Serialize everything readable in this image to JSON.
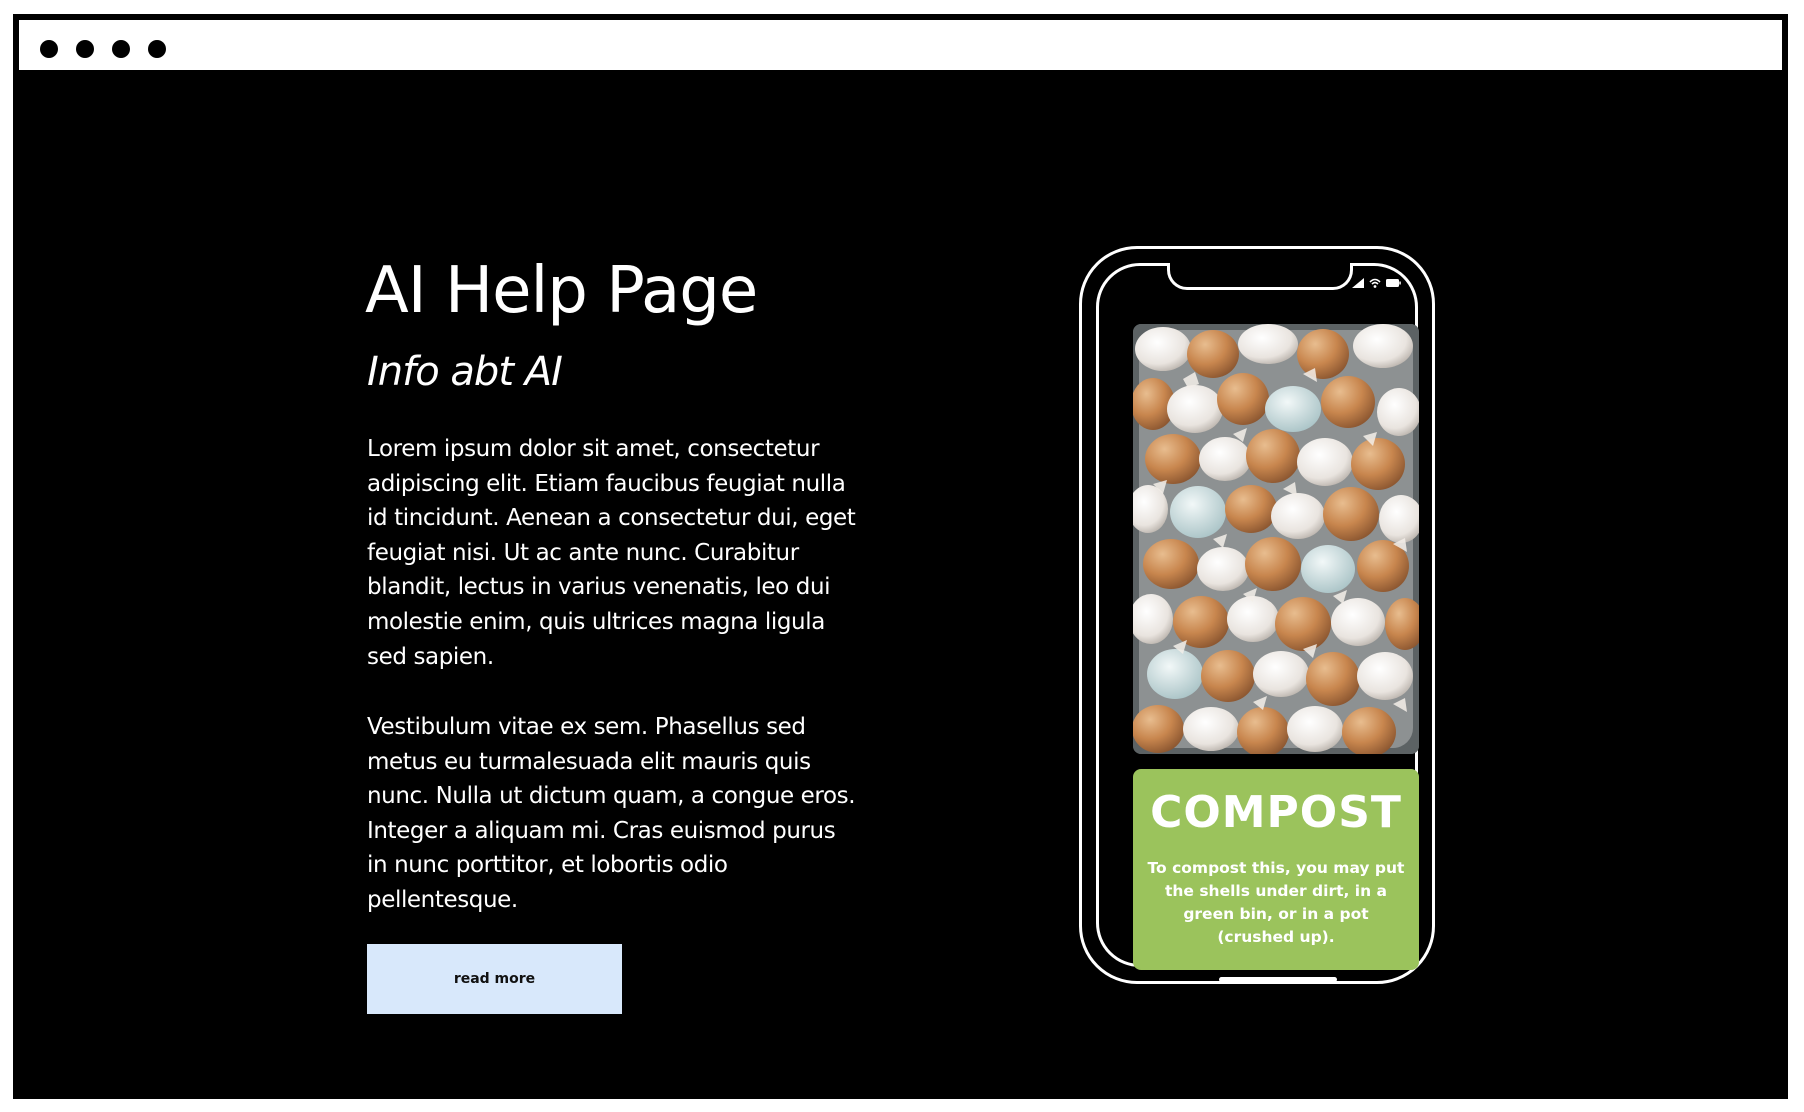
{
  "window": {
    "controls": [
      "dot",
      "dot",
      "dot",
      "dot"
    ]
  },
  "hero": {
    "title": "AI Help Page",
    "subtitle": "Info abt AI",
    "paragraph_1": "Lorem ipsum dolor sit amet, consectetur adipiscing elit. Etiam faucibus feugiat nulla id tincidunt. Aenean a consectetur dui, eget feugiat nisi. Ut ac ante nunc. Curabitur blandit, lectus in varius venenatis, leo dui molestie enim, quis ultrices magna ligula sed sapien.",
    "paragraph_2": "Vestibulum vitae ex sem. Phasellus sed metus eu turmalesuada elit mauris quis nunc. Nulla ut dictum quam, a congue eros. Integer a aliquam mi. Cras euismod purus in nunc porttitor, et lobortis odio pellentesque.",
    "button_label": "read more"
  },
  "phone": {
    "status_icons": [
      "signal-icon",
      "wifi-icon",
      "battery-icon"
    ],
    "photo_subject": "eggshells-photo",
    "card": {
      "title": "COMPOST",
      "description": "To compost this, you may put the shells under dirt, in a green bin, or in a pot (crushed up).",
      "color": "#9bc35c"
    }
  },
  "colors": {
    "background": "#000000",
    "button": "#d8e8fb",
    "text": "#ffffff"
  }
}
